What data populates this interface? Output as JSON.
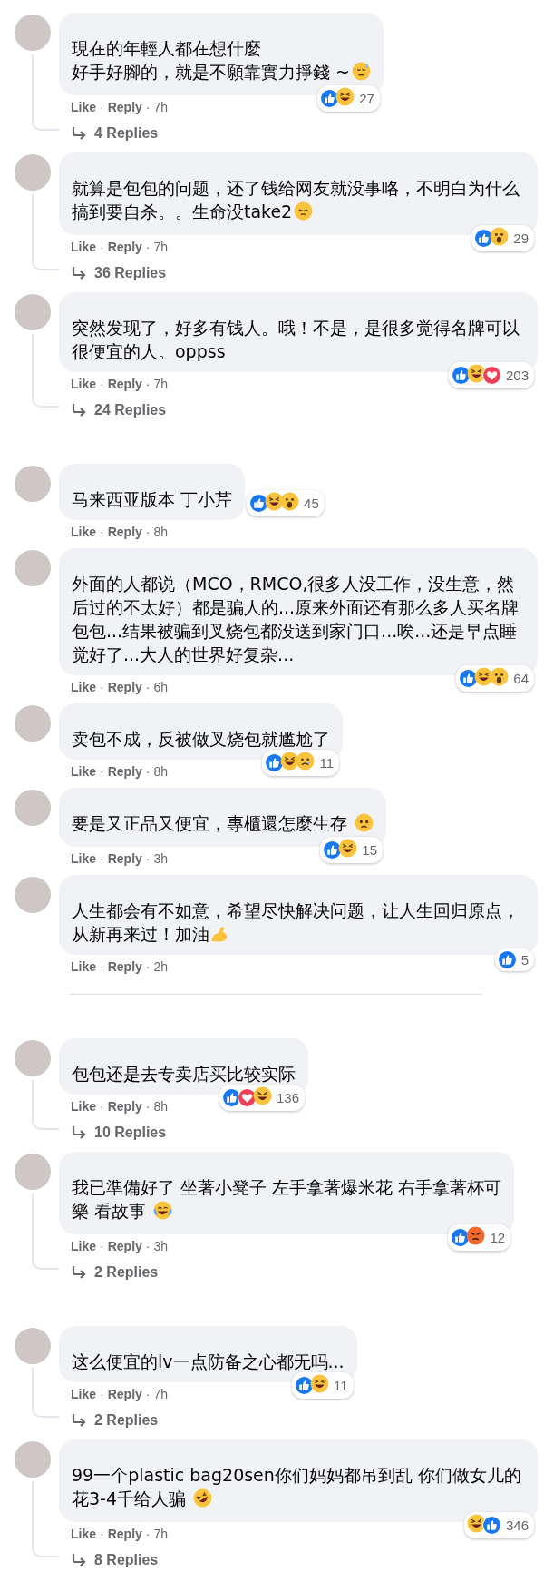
{
  "separator": "·",
  "sections": [
    {
      "divider": false,
      "comments": [
        {
          "text_lines": [
            "現在的年輕人都在想什麼",
            "好手好腳的，就是不願靠實力掙錢 ~"
          ],
          "emoji": {
            "kind": "sweat"
          },
          "actions": [
            "Like",
            "Reply"
          ],
          "time": "7h",
          "reactions": [
            {
              "kind": "like"
            },
            {
              "kind": "haha"
            }
          ],
          "count": "27",
          "replies": "4 Replies"
        },
        {
          "text_lines": [
            "就算是包包的问题，还了钱给网友就没事咯，不明白为什么搞到要自杀。。生命没take2"
          ],
          "emoji": {
            "kind": "pensive"
          },
          "actions": [
            "Like",
            "Reply"
          ],
          "time": "7h",
          "reactions": [
            {
              "kind": "like"
            },
            {
              "kind": "wow"
            }
          ],
          "count": "29",
          "replies": "36 Replies"
        },
        {
          "text_lines": [
            "突然发现了，好多有钱人。哦！不是，是很多觉得名牌可以很便宜的人。oppss"
          ],
          "actions": [
            "Like",
            "Reply"
          ],
          "time": "7h",
          "reactions": [
            {
              "kind": "like"
            },
            {
              "kind": "haha"
            },
            {
              "kind": "love"
            }
          ],
          "count": "203",
          "replies": "24 Replies"
        }
      ]
    },
    {
      "divider": true,
      "comments": [
        {
          "text_lines": [
            "马来西亚版本 丁小芹"
          ],
          "actions": [
            "Like",
            "Reply"
          ],
          "time": "8h",
          "reactions": [
            {
              "kind": "like"
            },
            {
              "kind": "haha"
            },
            {
              "kind": "wow"
            }
          ],
          "count": "45"
        },
        {
          "text_lines": [
            "外面的人都说（MCO，RMCO,很多人没工作，没生意，然后过的不太好）都是骗人的...原来外面还有那么多人买名牌包包...结果被骗到叉烧包都没送到家门口...唉...还是早点睡觉好了...大人的世界好复杂..."
          ],
          "actions": [
            "Like",
            "Reply"
          ],
          "time": "6h",
          "reactions": [
            {
              "kind": "like"
            },
            {
              "kind": "haha"
            },
            {
              "kind": "wow"
            }
          ],
          "count": "64"
        },
        {
          "text_lines": [
            "卖包不成，反被做叉烧包就尴尬了"
          ],
          "actions": [
            "Like",
            "Reply"
          ],
          "time": "8h",
          "reactions": [
            {
              "kind": "like"
            },
            {
              "kind": "haha"
            },
            {
              "kind": "sad"
            }
          ],
          "count": "11"
        },
        {
          "text_lines": [
            "要是又正品又便宜，專櫃還怎麼生存 "
          ],
          "emoji": {
            "kind": "worried"
          },
          "actions": [
            "Like",
            "Reply"
          ],
          "time": "3h",
          "reactions": [
            {
              "kind": "like"
            },
            {
              "kind": "haha"
            }
          ],
          "count": "15"
        },
        {
          "text_lines": [
            "人生都会有不如意，希望尽快解决问题，让人生回归原点，从新再来过！加油"
          ],
          "emoji": {
            "kind": "muscle"
          },
          "actions": [
            "Like",
            "Reply"
          ],
          "time": "2h",
          "reactions": [
            {
              "kind": "like"
            }
          ],
          "count": "5"
        }
      ]
    },
    {
      "divider": false,
      "comments": [
        {
          "text_lines": [
            "包包还是去专卖店买比较实际"
          ],
          "actions": [
            "Like",
            "Reply"
          ],
          "time": "8h",
          "reactions": [
            {
              "kind": "like"
            },
            {
              "kind": "love"
            },
            {
              "kind": "haha"
            }
          ],
          "count": "136",
          "replies": "10 Replies"
        },
        {
          "text_lines": [
            "我已準備好了 坐著小凳子 左手拿著爆米花 右手拿著杯可",
            "樂 看故事 "
          ],
          "emoji": {
            "kind": "joy"
          },
          "actions": [
            "Like",
            "Reply"
          ],
          "time": "3h",
          "reactions": [
            {
              "kind": "like"
            },
            {
              "kind": "angry"
            }
          ],
          "count": "12",
          "replies": "2 Replies"
        }
      ]
    },
    {
      "divider": false,
      "comments": [
        {
          "text_lines": [
            "这么便宜的lv一点防备之心都无吗..."
          ],
          "actions": [
            "Like",
            "Reply"
          ],
          "time": "7h",
          "reactions": [
            {
              "kind": "like"
            },
            {
              "kind": "haha"
            }
          ],
          "count": "11",
          "replies": "2 Replies"
        },
        {
          "text_lines": [
            "99一个plastic bag20sen你们妈妈都吊到乱 你们做女儿的花3-4千给人骗 "
          ],
          "emoji": {
            "kind": "rofl"
          },
          "actions": [
            "Like",
            "Reply"
          ],
          "time": "7h",
          "reactions": [
            {
              "kind": "haha"
            },
            {
              "kind": "like"
            }
          ],
          "count": "346",
          "replies": "8 Replies"
        }
      ]
    }
  ]
}
